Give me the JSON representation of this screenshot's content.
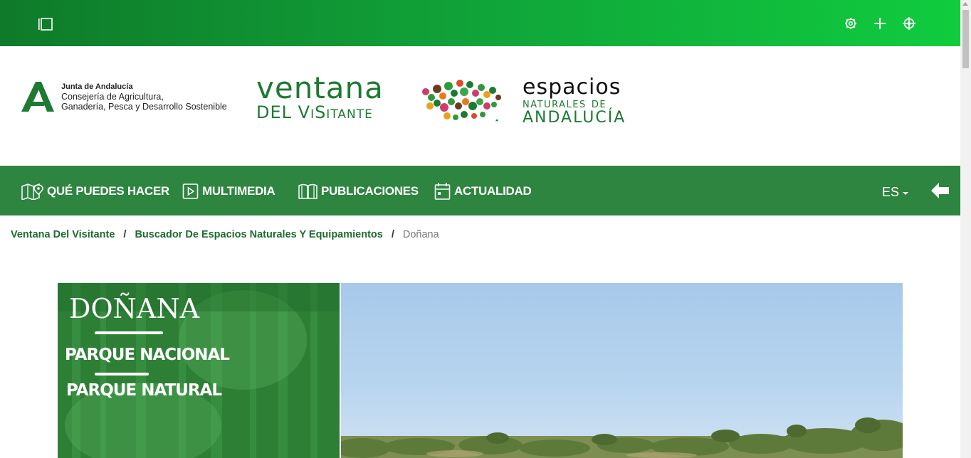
{
  "topbar": {
    "icons": [
      "sidebar-toggle-icon",
      "gear-icon",
      "plus-icon",
      "target-icon"
    ]
  },
  "header": {
    "junta": {
      "title": "Junta de Andalucía",
      "line1": "Consejería de Agricultura,",
      "line2": "Ganadería, Pesca y Desarrollo Sostenible"
    },
    "ventana": {
      "line1": "ventana",
      "line2": "DEL ViSitante"
    },
    "espacios": {
      "line1": "espacios",
      "line2": "naturales de",
      "line3": "ANDALUCÍA"
    }
  },
  "nav": {
    "items": [
      {
        "label": "QUÉ PUEDES HACER",
        "icon": "map-pin-icon"
      },
      {
        "label": "MULTIMEDIA",
        "icon": "play-icon"
      },
      {
        "label": "PUBLICACIONES",
        "icon": "book-icon"
      },
      {
        "label": "ACTUALIDAD",
        "icon": "calendar-icon"
      }
    ],
    "language": "ES"
  },
  "breadcrumb": {
    "items": [
      "Ventana Del Visitante",
      "Buscador De Espacios Naturales Y Equipamientos"
    ],
    "current": "Doñana",
    "separator": "/"
  },
  "hero": {
    "title": "DOÑANA",
    "line1": "PARQUE NACIONAL",
    "line2": "PARQUE NATURAL"
  },
  "colors": {
    "topbar_start": "#0f7a2a",
    "topbar_end": "#10cc3e",
    "nav_bg": "#2d8540",
    "brand_green": "#1d7a32"
  }
}
